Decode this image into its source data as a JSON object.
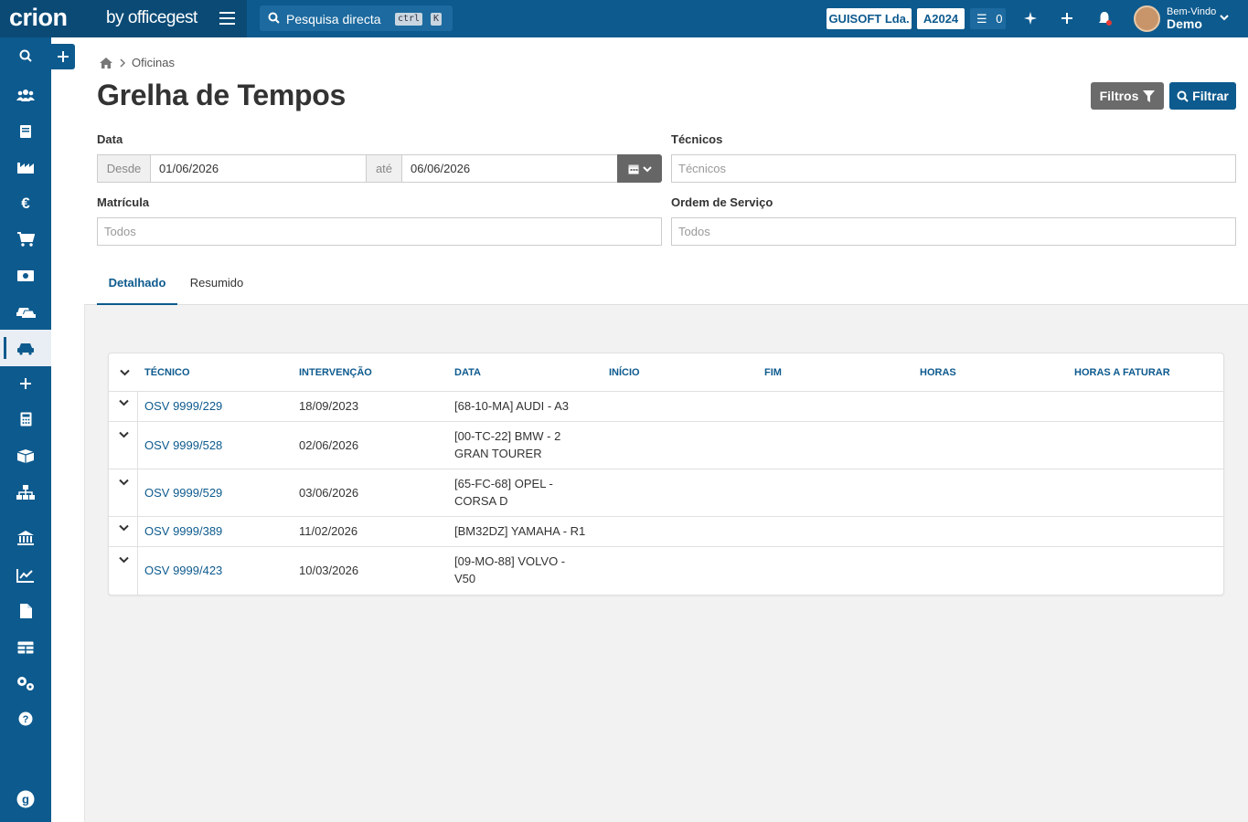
{
  "app": {
    "logo_text": "crion",
    "logo_by": "by officegest",
    "search_placeholder": "Pesquisa directa",
    "kbd_ctrl": "ctrl",
    "kbd_k": "K",
    "company": "GUISOFT Lda.",
    "year": "A2024",
    "task_count": "0",
    "welcome": "Bem-Vindo",
    "user_name": "Demo",
    "accent_color": "#0d5a8e"
  },
  "sidebar": {
    "items": [
      {
        "icon": "search-icon"
      },
      {
        "icon": "users-icon"
      },
      {
        "icon": "book-icon"
      },
      {
        "icon": "factory-icon"
      },
      {
        "icon": "euro-icon"
      },
      {
        "icon": "cart-icon"
      },
      {
        "icon": "money-icon"
      },
      {
        "icon": "car-wash-icon"
      },
      {
        "icon": "car-icon",
        "active": true
      },
      {
        "icon": "plus-icon"
      },
      {
        "icon": "calculator-icon"
      },
      {
        "icon": "box-icon"
      },
      {
        "icon": "hierarchy-icon"
      },
      {
        "icon": "bank-icon"
      },
      {
        "icon": "chart-icon"
      },
      {
        "icon": "file-icon"
      },
      {
        "icon": "table-icon"
      },
      {
        "icon": "settings-icon"
      },
      {
        "icon": "help-icon"
      }
    ]
  },
  "breadcrumb": {
    "current": "Oficinas"
  },
  "page": {
    "title": "Grelha de Tempos",
    "btn_filtros": "Filtros",
    "btn_filtrar": "Filtrar"
  },
  "filters": {
    "data_label": "Data",
    "desde_label": "Desde",
    "desde_value": "01/06/2026",
    "ate_label": "até",
    "ate_value": "06/06/2026",
    "tecnicos_label": "Técnicos",
    "tecnicos_placeholder": "Técnicos",
    "matricula_label": "Matrícula",
    "matricula_placeholder": "Todos",
    "ordem_label": "Ordem de Serviço",
    "ordem_placeholder": "Todos"
  },
  "tabs": [
    {
      "label": "Detalhado",
      "active": true
    },
    {
      "label": "Resumido",
      "active": false
    }
  ],
  "table": {
    "columns": [
      "TÉCNICO",
      "INTERVENÇÃO",
      "DATA",
      "INÍCIO",
      "FIM",
      "HORAS",
      "HORAS A FATURAR"
    ],
    "rows": [
      {
        "tecnico": "OSV 9999/229",
        "intervencao": "18/09/2023",
        "data_l1": "[68-10-MA] AUDI - A3",
        "data_l2": ""
      },
      {
        "tecnico": "OSV 9999/528",
        "intervencao": "02/06/2026",
        "data_l1": "[00-TC-22] BMW - 2",
        "data_l2": "GRAN TOURER"
      },
      {
        "tecnico": "OSV 9999/529",
        "intervencao": "03/06/2026",
        "data_l1": "[65-FC-68] OPEL -",
        "data_l2": "CORSA D"
      },
      {
        "tecnico": "OSV 9999/389",
        "intervencao": "11/02/2026",
        "data_l1": "[BM32DZ] YAMAHA - R1",
        "data_l2": ""
      },
      {
        "tecnico": "OSV 9999/423",
        "intervencao": "10/03/2026",
        "data_l1": "[09-MO-88] VOLVO -",
        "data_l2": "V50"
      }
    ]
  }
}
